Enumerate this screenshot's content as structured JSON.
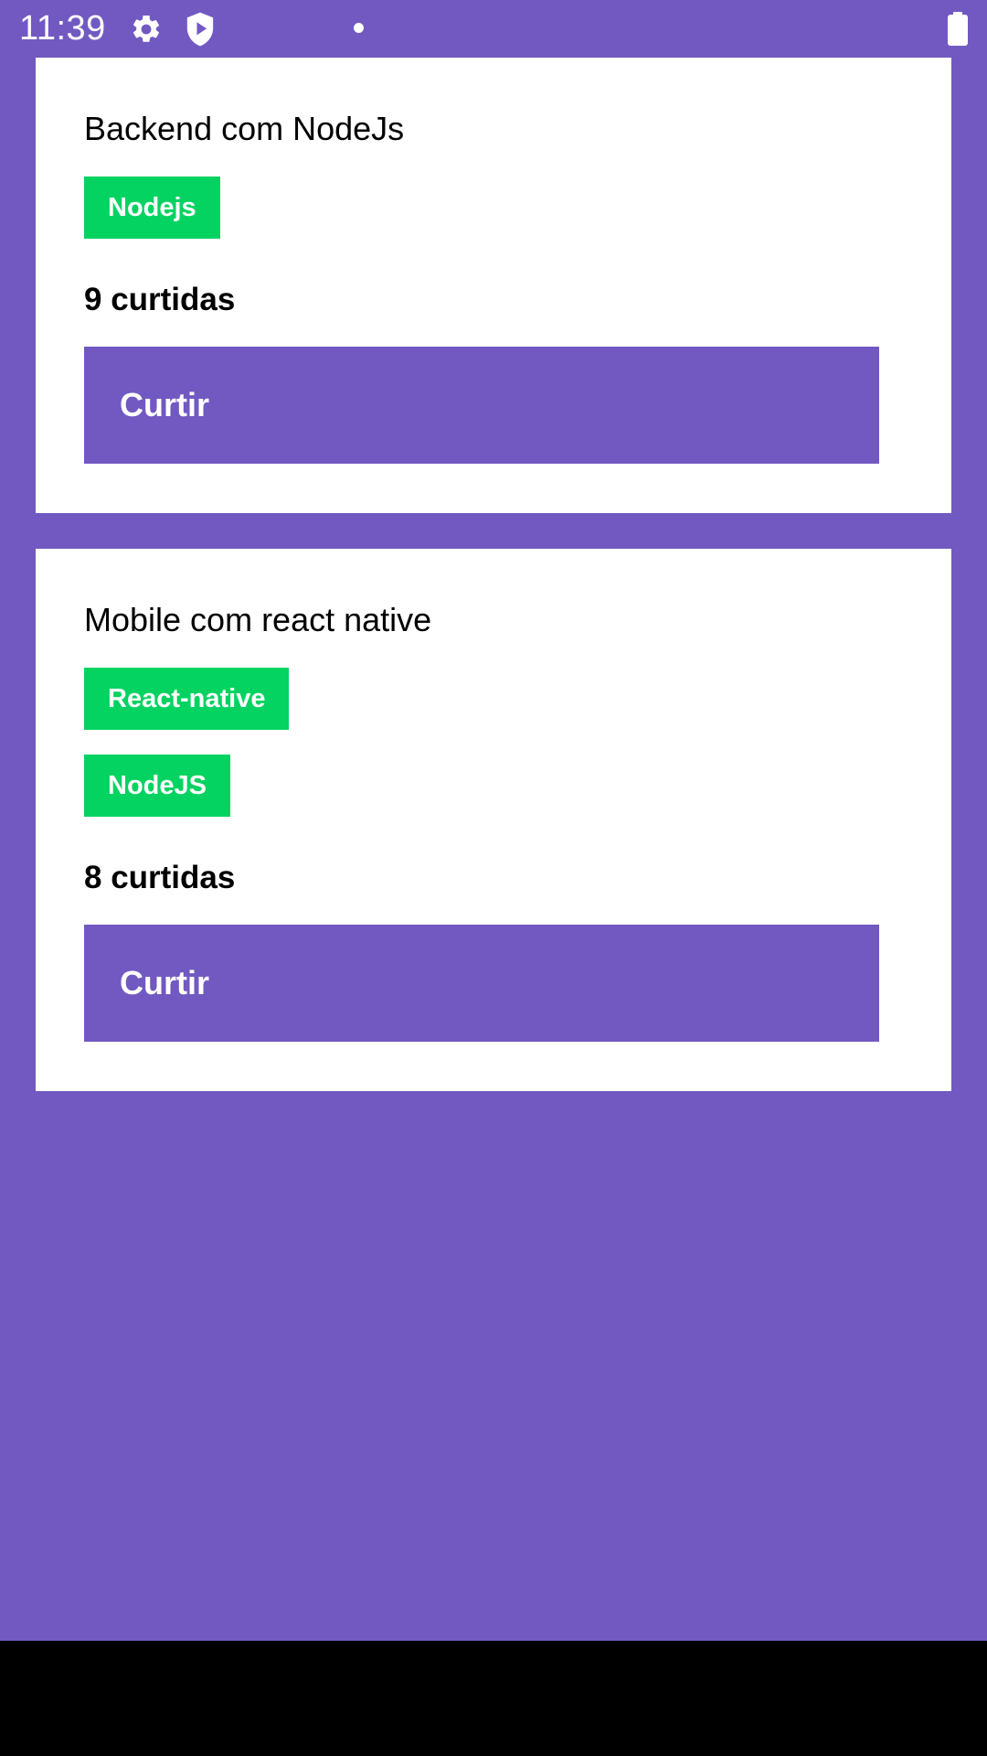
{
  "status_bar": {
    "time": "11:39",
    "icons": [
      "gear-icon",
      "shield-play-icon",
      "notification-dot-icon",
      "battery-icon"
    ]
  },
  "colors": {
    "background": "#7159c1",
    "card": "#ffffff",
    "tag": "#04d361",
    "button": "#7159c1",
    "nav_bar": "#000000"
  },
  "repositories": [
    {
      "title": "Backend com NodeJs",
      "techs": [
        "Nodejs"
      ],
      "likes_text": "9 curtidas",
      "like_button_label": "Curtir"
    },
    {
      "title": "Mobile com react native",
      "techs": [
        "React-native",
        "NodeJS"
      ],
      "likes_text": "8 curtidas",
      "like_button_label": "Curtir"
    }
  ]
}
